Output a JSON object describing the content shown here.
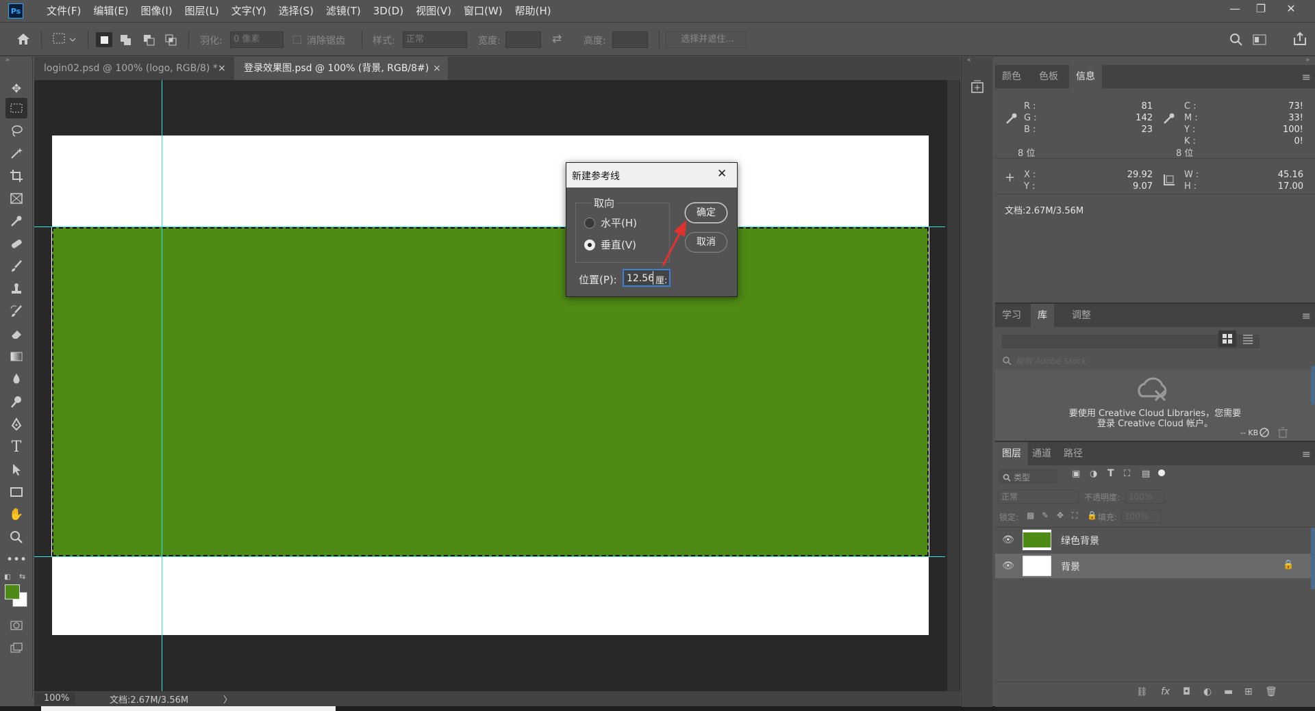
{
  "menubar": {
    "logo": "Ps",
    "items": [
      "文件(F)",
      "编辑(E)",
      "图像(I)",
      "图层(L)",
      "文字(Y)",
      "选择(S)",
      "滤镜(T)",
      "3D(D)",
      "视图(V)",
      "窗口(W)",
      "帮助(H)"
    ],
    "window_controls": {
      "minimize": "—",
      "restore": "❐",
      "close": "✕"
    }
  },
  "options": {
    "feather_label": "羽化:",
    "feather_value": "0 像素",
    "antialias_label": "消除锯齿",
    "style_label": "样式:",
    "style_value": "正常",
    "width_label": "宽度:",
    "height_label": "高度:",
    "select_mask_label": "选择并遮住..."
  },
  "tabs": [
    {
      "label": "login02.psd @ 100% (logo, RGB/8) *",
      "close": "×"
    },
    {
      "label": "登录效果图.psd @ 100% (背景, RGB/8#)",
      "close": "×"
    }
  ],
  "status": {
    "zoom": "100%",
    "doc": "文档:2.67M/3.56M",
    "arrow": "〉"
  },
  "dialog": {
    "title": "新建参考线",
    "close": "✕",
    "group_label": "取向",
    "horizontal_label": "水平(H)",
    "vertical_label": "垂直(V)",
    "selected": "vertical",
    "ok_label": "确定",
    "cancel_label": "取消",
    "position_label": "位置(P):",
    "position_value": "12.56",
    "position_unit": "厘:"
  },
  "info_panel": {
    "tabs": [
      "颜色",
      "色板",
      "信息"
    ],
    "active_tab": "信息",
    "rgb": {
      "R": "81",
      "G": "142",
      "B": "23",
      "bits": "8 位"
    },
    "cmyk": {
      "C": "73!",
      "M": "33!",
      "Y": "100!",
      "K": "0!",
      "bits": "8 位"
    },
    "xy": {
      "X": "29.92",
      "Y": "9.07"
    },
    "wh": {
      "W": "45.16",
      "H": "17.00"
    },
    "doc": "文档:2.67M/3.56M",
    "labels": {
      "R": "R :",
      "G": "G :",
      "B": "B :",
      "C": "C :",
      "M": "M :",
      "Y": "Y :",
      "K": "K :",
      "X": "X :",
      "Yc": "Y :",
      "W": "W :",
      "H": "H :"
    }
  },
  "library_panel": {
    "tabs": [
      "学习",
      "库",
      "调整"
    ],
    "active_tab": "库",
    "search_placeholder": "搜索 Adobe Stock",
    "message_line1": "要使用 Creative Cloud Libraries，您需要",
    "message_line2": "登录 Creative Cloud 帐户。",
    "size": "-- KB"
  },
  "layers_panel": {
    "tabs": [
      "图层",
      "通道",
      "路径"
    ],
    "active_tab": "图层",
    "filter_label": "类型",
    "blend_mode": "正常",
    "opacity_label": "不透明度:",
    "opacity_value": "100%",
    "lock_label": "锁定:",
    "fill_label": "填充:",
    "fill_value": "100%",
    "layers": [
      {
        "name": "绿色背景",
        "color": "#4e8a16",
        "selected": false,
        "locked": false
      },
      {
        "name": "背景",
        "color": "#ffffff",
        "selected": true,
        "locked": true
      }
    ],
    "footer_icons": [
      "link-icon",
      "fx-icon",
      "mask-icon",
      "adjustment-icon",
      "folder-icon",
      "new-layer-icon",
      "trash-icon"
    ],
    "fx_label": "fx"
  },
  "colors": {
    "foreground": "#4e8a16",
    "background": "#ffffff",
    "guide": "#2fe6e6",
    "canvas_green": "#4e8a16"
  }
}
